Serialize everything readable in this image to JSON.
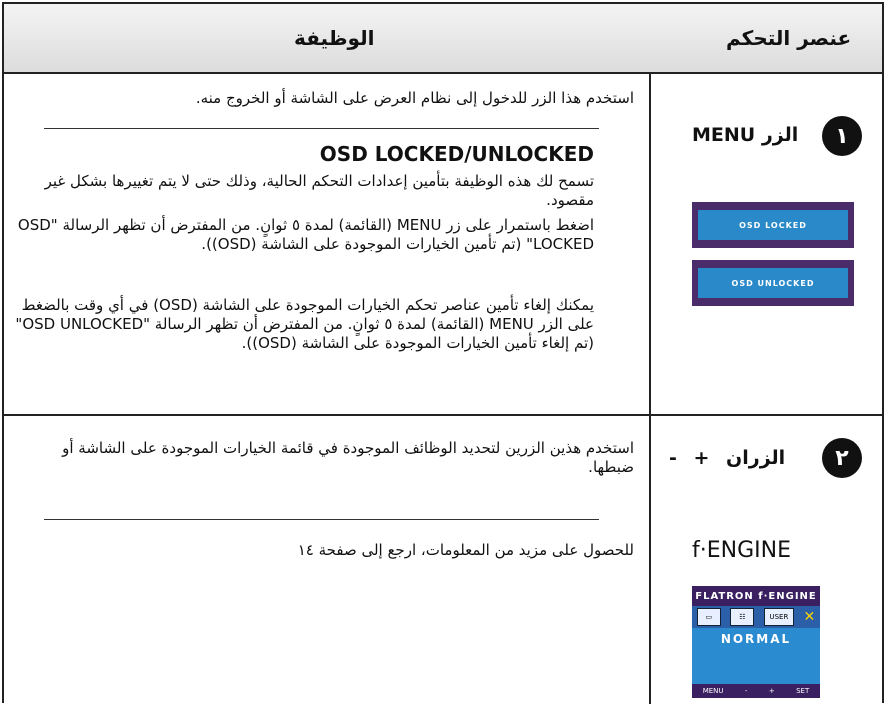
{
  "header": {
    "function_col": "الوظيفة",
    "control_col": "عنصر التحكم"
  },
  "row1": {
    "number": "١",
    "control_label": "الزر MENU",
    "description": "استخدم هذا الزر للدخول إلى نظام العرض على الشاشة أو الخروج منه."
  },
  "row2": {
    "title": "OSD LOCKED/UNLOCKED",
    "para1": "تسمح لك هذه الوظيفة بتأمين إعدادات التحكم الحالية، وذلك حتى لا يتم تغييرها بشكل غير مقصود.",
    "para2": "اضغط باستمرار على زر MENU (القائمة) لمدة ٥ ثوانٍ. من المفترض أن تظهر الرسالة \"OSD LOCKED\" (تم تأمين الخيارات الموجودة على الشاشة (OSD)).",
    "para3": "يمكنك إلغاء تأمين عناصر تحكم الخيارات الموجودة على الشاشة (OSD) في أي وقت بالضغط على الزر MENU (القائمة) لمدة ٥ ثوانٍ. من المفترض أن تظهر الرسالة \"OSD UNLOCKED\" (تم إلغاء تأمين الخيارات الموجودة على الشاشة (OSD)).",
    "locked_label": "OSD LOCKED",
    "unlocked_label": "OSD UNLOCKED"
  },
  "row3": {
    "number": "٢",
    "control_label": "الزران  +  -",
    "description": "استخدم هذين الزرين لتحديد الوظائف الموجودة في قائمة الخيارات الموجودة على الشاشة أو ضبطها."
  },
  "row4": {
    "control_label": "f·ENGINE",
    "description": "للحصول على مزيد من المعلومات، ارجع إلى صفحة ١٤",
    "osd_title": "FLATRON f·ENGINE",
    "osd_icons": [
      "▭",
      "☷",
      "USER",
      "✕"
    ],
    "osd_mode": "NORMAL",
    "osd_footer": [
      "MENU",
      "-",
      "+",
      "SET"
    ]
  },
  "colors": {
    "osd_frame": "#4b2c6a",
    "osd_fill": "#2a89c9"
  }
}
